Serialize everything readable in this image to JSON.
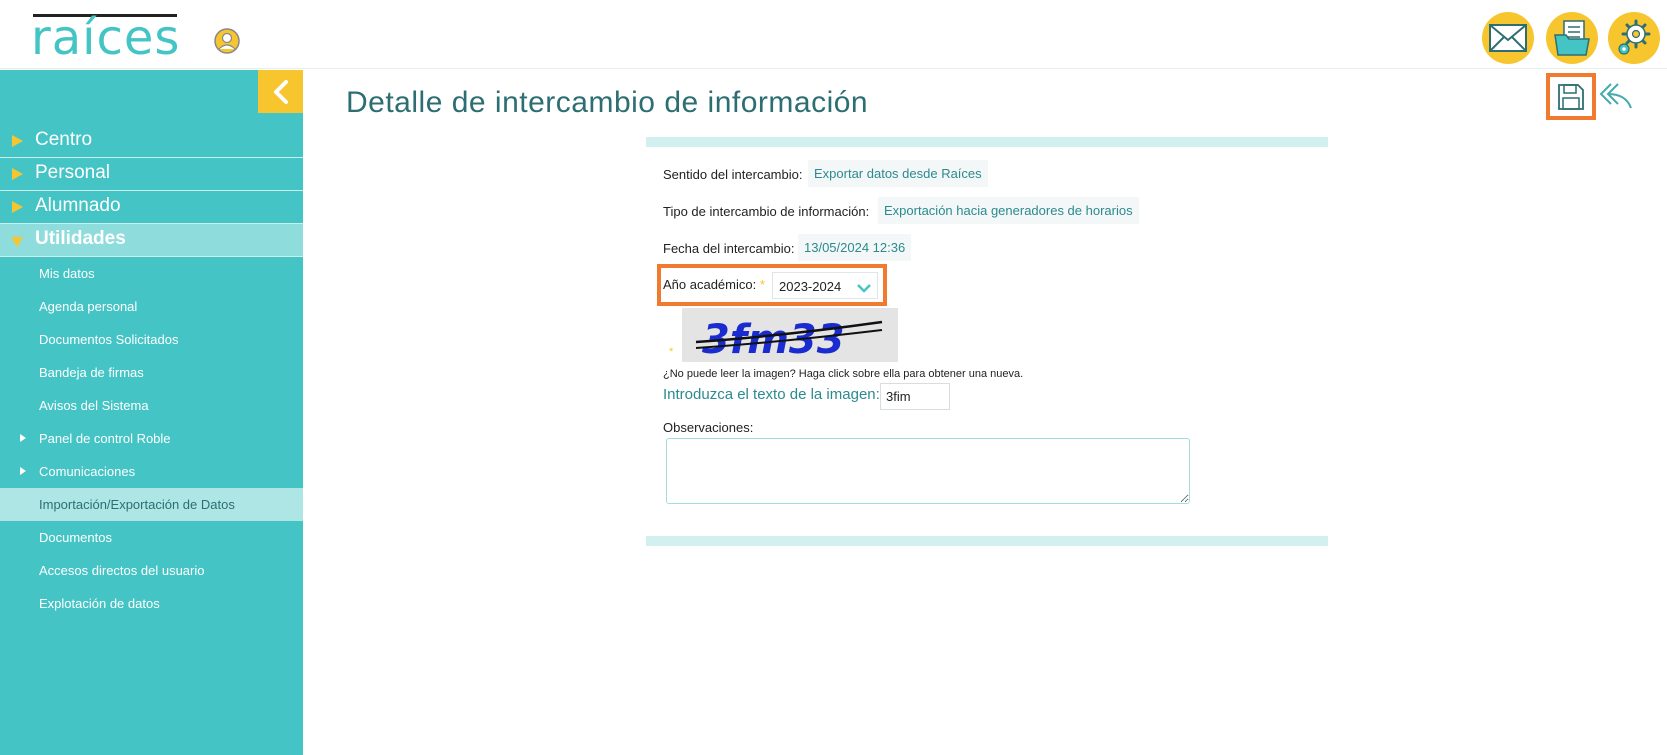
{
  "header": {
    "logo_text": "raíces",
    "icons": {
      "user": "user-circle-icon",
      "mail": "envelope-icon",
      "docs": "folder-documents-icon",
      "settings": "gear-icon"
    }
  },
  "sidebar": {
    "collapse_icon": "chevron-left-icon",
    "top_items": [
      {
        "label": "Centro"
      },
      {
        "label": "Personal"
      },
      {
        "label": "Alumnado"
      },
      {
        "label": "Utilidades"
      }
    ],
    "sub_items": [
      {
        "label": "Mis datos"
      },
      {
        "label": "Agenda personal"
      },
      {
        "label": "Documentos Solicitados"
      },
      {
        "label": "Bandeja de firmas"
      },
      {
        "label": "Avisos del Sistema"
      },
      {
        "label": "Panel de control Roble"
      },
      {
        "label": "Comunicaciones"
      },
      {
        "label": "Importación/Exportación de Datos"
      },
      {
        "label": "Documentos"
      },
      {
        "label": "Accesos directos del usuario"
      },
      {
        "label": "Explotación de datos"
      }
    ]
  },
  "main": {
    "title": "Detalle de intercambio de información",
    "toolbar": {
      "save_icon": "save-icon",
      "back_icon": "reply-back-icon"
    },
    "form": {
      "sentido_label": "Sentido del intercambio:",
      "sentido_value": "Exportar datos desde Raíces",
      "tipo_label": "Tipo de intercambio de información:",
      "tipo_value": "Exportación hacia generadores de horarios",
      "fecha_label": "Fecha del intercambio:",
      "fecha_value": "13/05/2024 12:36",
      "anio_label": "Año académico:",
      "required_mark": "*",
      "anio_value": "2023-2024",
      "captcha_text": "3fm33",
      "captcha_help": "¿No puede leer la imagen? Haga click sobre ella para obtener una nueva.",
      "captcha_label": "Introduzca el texto de la imagen:",
      "captcha_input_value": "3fim",
      "obs_label": "Observaciones:",
      "obs_value": ""
    }
  },
  "colors": {
    "accent_teal": "#45c4c5",
    "accent_yellow": "#f7c62f",
    "highlight_orange": "#f07a2f",
    "title_teal": "#2c6e72"
  }
}
